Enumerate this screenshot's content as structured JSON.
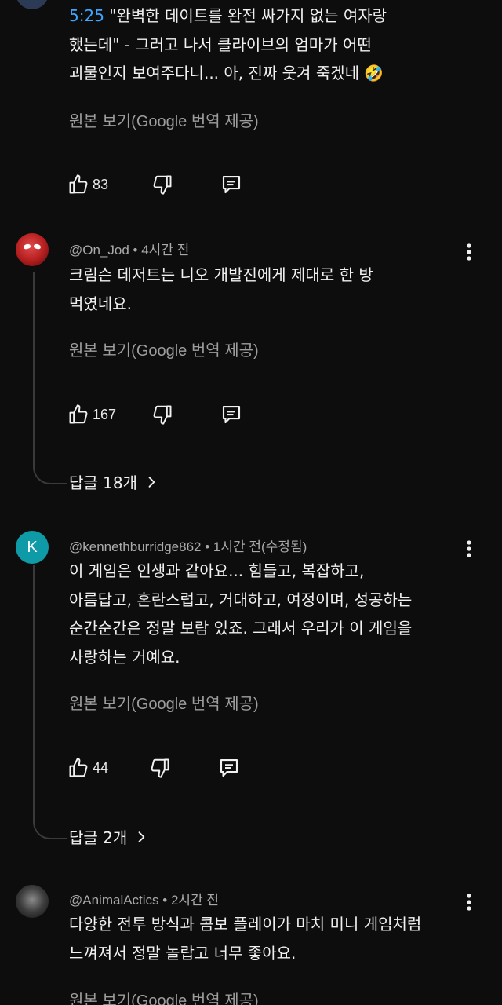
{
  "comments": [
    {
      "timestamp": "5:25",
      "text_after_ts": " \"완벽한 데이트를 완전 싸가지 없는 여자랑\n했는데\" - 그러고 나서 클라이브의 엄마가 어떤\n괴물인지 보여주다니... 아, 진짜 웃겨 죽겠네",
      "emoji": "🤣",
      "translate": "원본 보기(Google 번역 제공)",
      "likes": "83"
    },
    {
      "author": "@On_Jod",
      "time": "4시간 전",
      "text": "크림슨 데저트는 니오 개발진에게 제대로 한 방\n먹였네요.",
      "translate": "원본 보기(Google 번역 제공)",
      "likes": "167",
      "replies": "답글 18개"
    },
    {
      "author": "@kennethburridge862",
      "time": "1시간 전(수정됨)",
      "avatar_letter": "K",
      "avatar_color": "#0f9aa8",
      "text": "이 게임은 인생과 같아요... 힘들고, 복잡하고,\n아름답고, 혼란스럽고, 거대하고, 여정이며, 성공하는\n순간순간은 정말 보람 있죠. 그래서 우리가 이 게임을\n사랑하는 거예요.",
      "translate": "원본 보기(Google 번역 제공)",
      "likes": "44",
      "replies": "답글 2개"
    },
    {
      "author": "@AnimalActics",
      "time": "2시간 전",
      "text": "다양한 전투 방식과 콤보 플레이가 마치 미니 게임처럼\n느껴져서 정말 놀랍고 너무 좋아요.",
      "translate": "원본 보기(Google 번역 제공)"
    }
  ],
  "colors": {
    "timestamp": "#3ea6ff",
    "background": "#0d0d0d",
    "meta": "#aaaaaa"
  },
  "icons": [
    "like-icon",
    "dislike-icon",
    "reply-icon",
    "more-icon",
    "chevron-right-icon"
  ]
}
